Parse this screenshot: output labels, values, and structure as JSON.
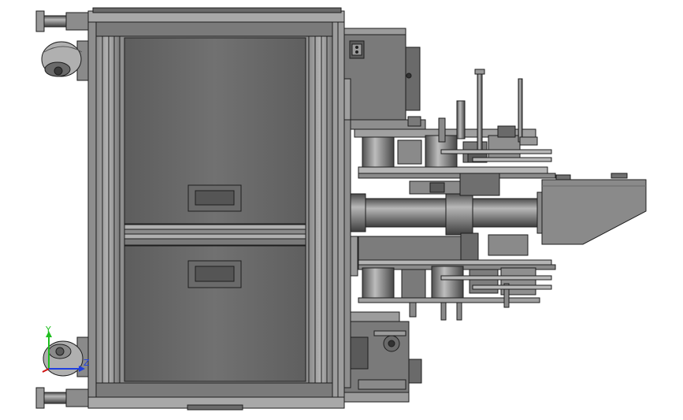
{
  "view": {
    "background": "#ffffff",
    "palette": {
      "steel": "#7d7d7d",
      "steel_dark": "#4a4a4a",
      "steel_light": "#a6a6a6",
      "panel": "#6e6e6e",
      "edge": "#1e1e1e",
      "highlight": "#c4c4c4"
    }
  },
  "triad": {
    "y_label": "Y",
    "z_label": "Z",
    "y_color": "#1fbf1f",
    "x_color": "#d01010",
    "z_color": "#1f3fe0",
    "icon": "axis-triad-icon"
  }
}
